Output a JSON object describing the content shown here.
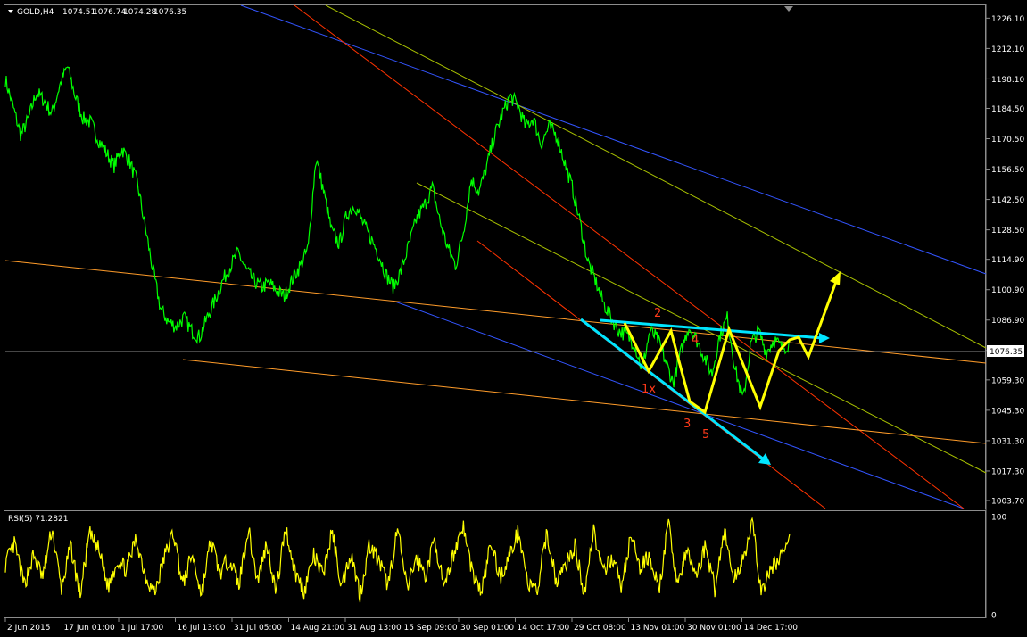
{
  "chart_window": {
    "symbol_label": "GOLD,H4",
    "ohlc": [
      "1074.51",
      "1076.74",
      "1074.28",
      "1076.35"
    ],
    "colors": {
      "background": "#000000",
      "frame": "#8c8c8c",
      "price_line": "#00ff00",
      "rsi_line": "#ffff00",
      "blue_channel": "#3355ff",
      "red_channel": "#ff3300",
      "olive_channel": "#a8c000",
      "orange_lines": "#ff9c2a",
      "cyan_wedge": "#00e5ff",
      "yellow_projection": "#ffff00",
      "wave_labels": "#ff3a1a",
      "current_price_badge": "#ffffff"
    }
  },
  "chart_data": [
    {
      "type": "line",
      "panel": "price",
      "series": [
        {
          "values": [
            1198,
            1185,
            1172,
            1180,
            1192,
            1188,
            1182,
            1195,
            1204,
            1190,
            1180,
            1178,
            1170,
            1164,
            1158,
            1166,
            1160,
            1150,
            1130,
            1110,
            1092,
            1086,
            1084,
            1088,
            1082,
            1079,
            1088,
            1096,
            1105,
            1112,
            1118,
            1110,
            1105,
            1102,
            1104,
            1100,
            1098,
            1106,
            1112,
            1120,
            1162,
            1146,
            1128,
            1122,
            1136,
            1140,
            1132,
            1125,
            1118,
            1108,
            1102,
            1110,
            1122,
            1134,
            1140,
            1148,
            1132,
            1120,
            1112,
            1128,
            1152,
            1146,
            1158,
            1172,
            1182,
            1190,
            1186,
            1176,
            1180,
            1168,
            1176,
            1172,
            1160,
            1148,
            1132,
            1114,
            1105,
            1095,
            1088,
            1082,
            1080,
            1076,
            1064,
            1082,
            1078,
            1068,
            1058,
            1072,
            1084,
            1078,
            1070,
            1062,
            1080,
            1088,
            1064,
            1050,
            1076,
            1082,
            1072,
            1078,
            1074,
            1076
          ]
        }
      ],
      "y_ticks": [
        "1226.10",
        "1212.10",
        "1198.10",
        "1184.50",
        "1170.50",
        "1156.50",
        "1142.50",
        "1128.50",
        "1114.90",
        "1100.90",
        "1086.90",
        "1072.90",
        "1059.30",
        "1045.30",
        "1031.30",
        "1017.30",
        "1003.70"
      ],
      "ylim": [
        1000.0,
        1232.0
      ],
      "current_price": "1076.35",
      "grid": false
    },
    {
      "type": "line",
      "panel": "indicator",
      "title": "RSI(5) 71.2821",
      "series": [
        {
          "values": [
            52,
            72,
            30,
            60,
            38,
            88,
            26,
            70,
            20,
            82,
            66,
            28,
            56,
            46,
            78,
            40,
            22,
            58,
            84,
            30,
            62,
            20,
            76,
            42,
            58,
            30,
            88,
            34,
            74,
            22,
            90,
            44,
            24,
            60,
            40,
            86,
            28,
            64,
            20,
            72,
            54,
            30,
            88,
            26,
            58,
            40,
            78,
            24,
            62,
            92,
            44,
            22,
            74,
            38,
            60,
            86,
            30,
            24,
            84,
            34,
            50,
            70,
            22,
            88,
            40,
            60,
            28,
            80,
            46,
            62,
            24,
            92,
            32,
            64,
            40,
            70,
            26,
            88,
            34,
            58,
            92,
            22,
            46,
            60,
            74
          ]
        }
      ],
      "y_ticks": [
        "100",
        "0"
      ],
      "ylim": [
        0,
        100
      ]
    }
  ],
  "time_axis": [
    "2 Jun 2015",
    "17 Jun 01:00",
    "1 Jul 17:00",
    "16 Jul 13:00",
    "31 Jul 05:00",
    "14 Aug 21:00",
    "31 Aug 13:00",
    "15 Sep 09:00",
    "30 Sep 01:00",
    "14 Oct 17:00",
    "29 Oct 08:00",
    "13 Nov 01:00",
    "30 Nov 01:00",
    "14 Dec 17:00"
  ],
  "wave_labels": [
    "1x",
    "2",
    "3",
    "4",
    "5"
  ]
}
